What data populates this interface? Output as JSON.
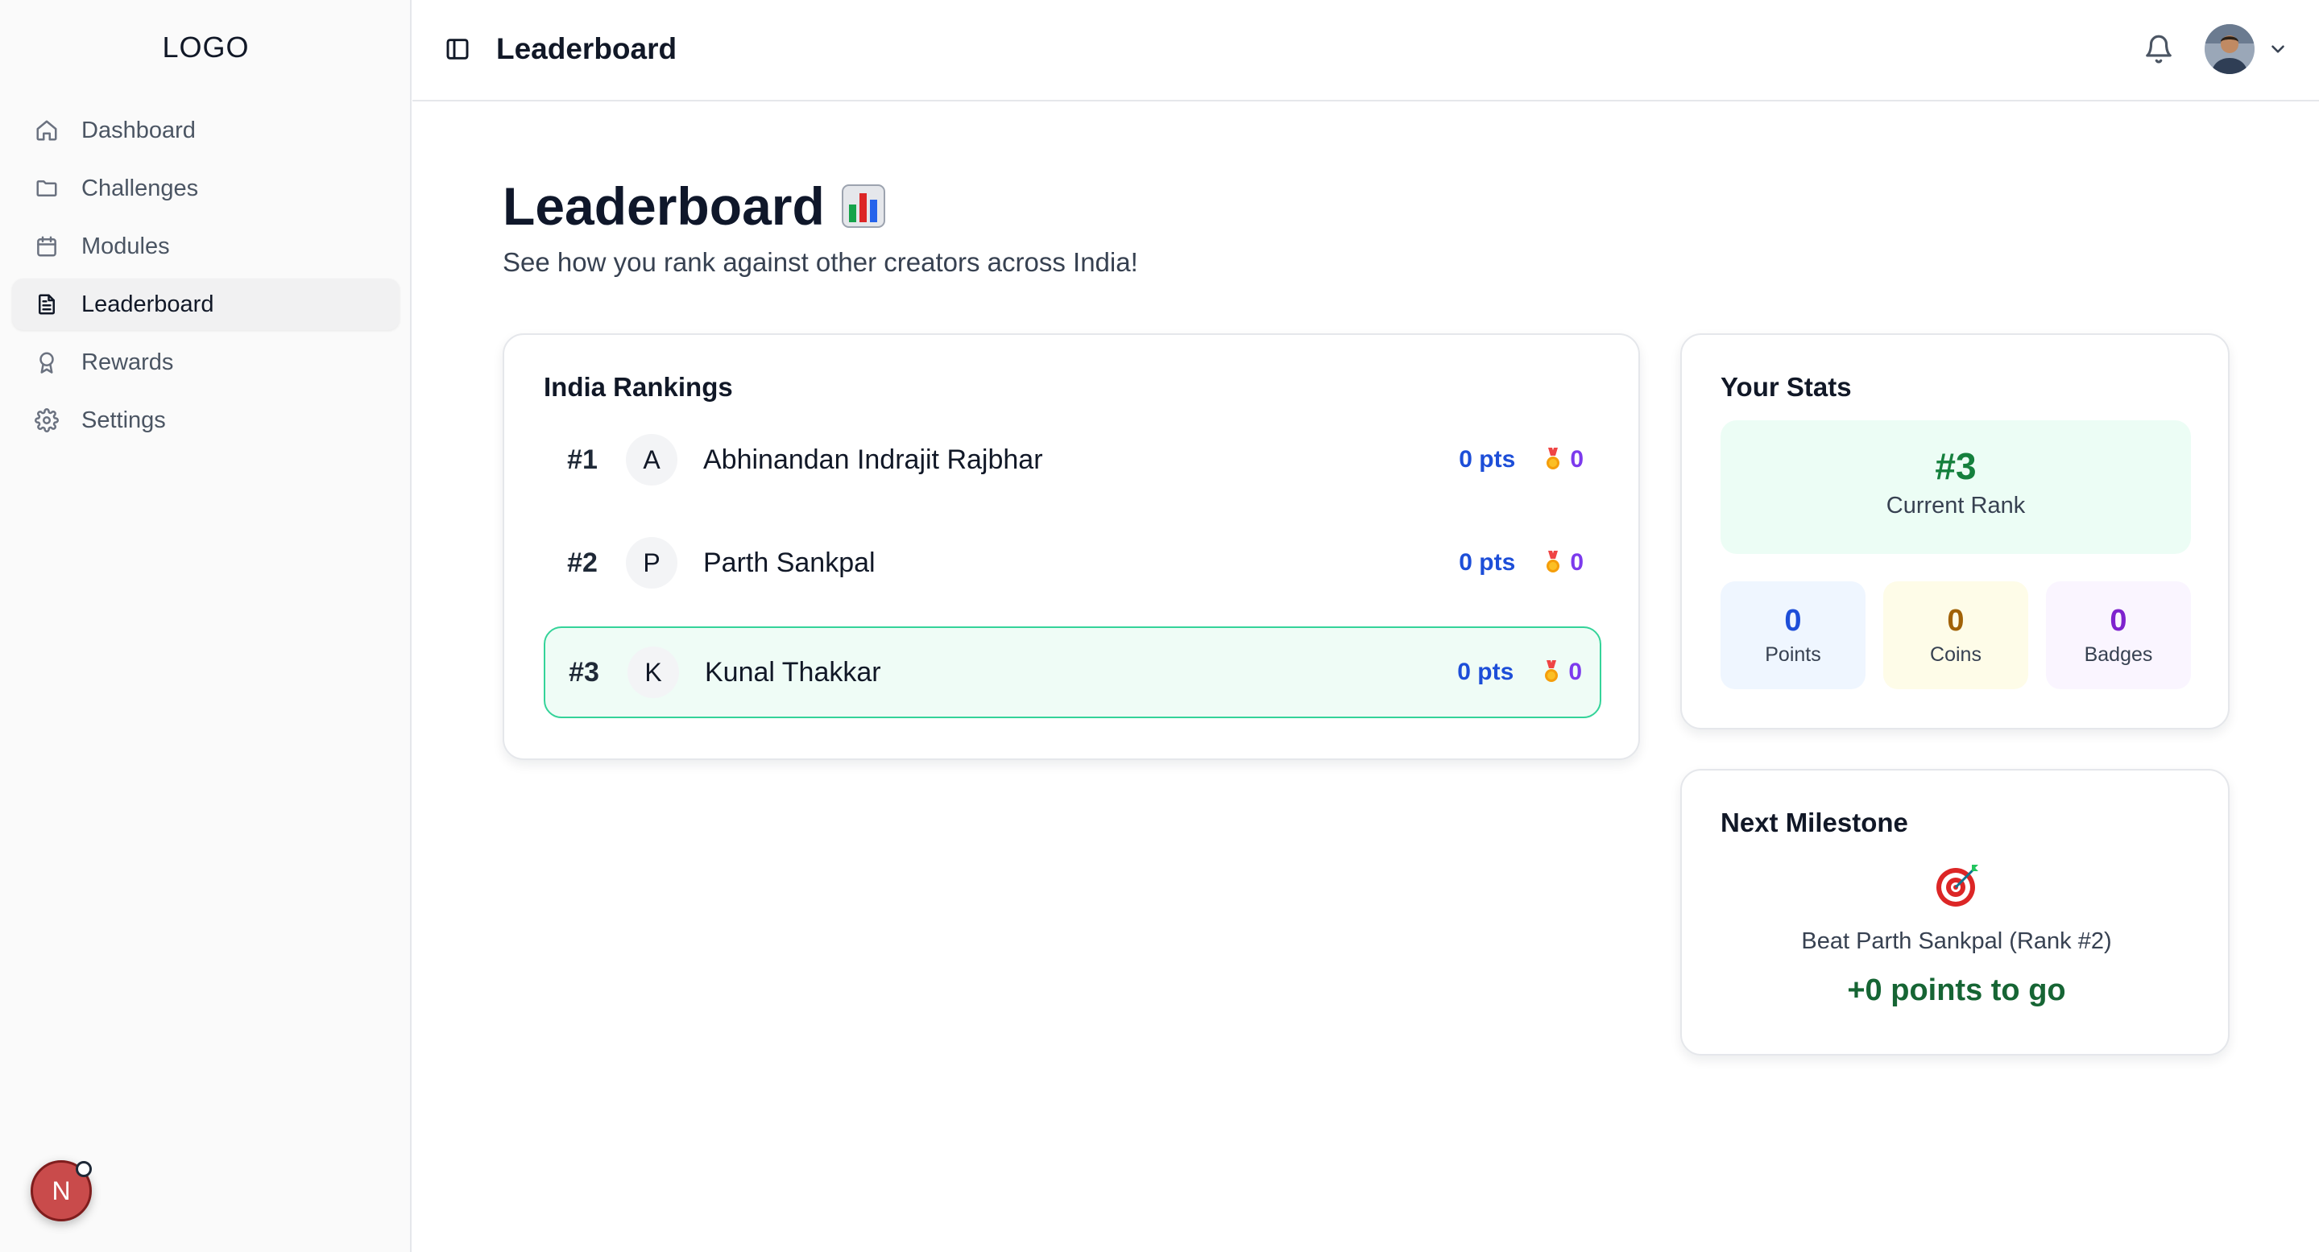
{
  "sidebar": {
    "logo": "LOGO",
    "items": [
      {
        "label": "Dashboard",
        "icon": "home-icon"
      },
      {
        "label": "Challenges",
        "icon": "folder-icon"
      },
      {
        "label": "Modules",
        "icon": "calendar-icon"
      },
      {
        "label": "Leaderboard",
        "icon": "document-icon",
        "active": true
      },
      {
        "label": "Rewards",
        "icon": "award-icon"
      },
      {
        "label": "Settings",
        "icon": "gear-icon"
      }
    ],
    "floating_avatar_initial": "N"
  },
  "header": {
    "title": "Leaderboard"
  },
  "page": {
    "title": "Leaderboard",
    "subtitle": "See how you rank against other creators across India!"
  },
  "rankings": {
    "title": "India Rankings",
    "rows": [
      {
        "rank": "#1",
        "initial": "A",
        "name": "Abhinandan Indrajit Rajbhar",
        "points": "0 pts",
        "badges": "0"
      },
      {
        "rank": "#2",
        "initial": "P",
        "name": "Parth Sankpal",
        "points": "0 pts",
        "badges": "0"
      },
      {
        "rank": "#3",
        "initial": "K",
        "name": "Kunal Thakkar",
        "points": "0 pts",
        "badges": "0",
        "highlight": true
      }
    ]
  },
  "stats": {
    "title": "Your Stats",
    "rank_value": "#3",
    "rank_label": "Current Rank",
    "points_value": "0",
    "points_label": "Points",
    "coins_value": "0",
    "coins_label": "Coins",
    "badges_value": "0",
    "badges_label": "Badges"
  },
  "milestone": {
    "title": "Next Milestone",
    "text": "Beat Parth Sankpal (Rank #2)",
    "to_go": "+0 points to go"
  },
  "colors": {
    "points_blue": "#1d4ed8",
    "badge_purple": "#7c3aed",
    "highlight_green": "#34d399",
    "rank_green": "#15803d"
  }
}
